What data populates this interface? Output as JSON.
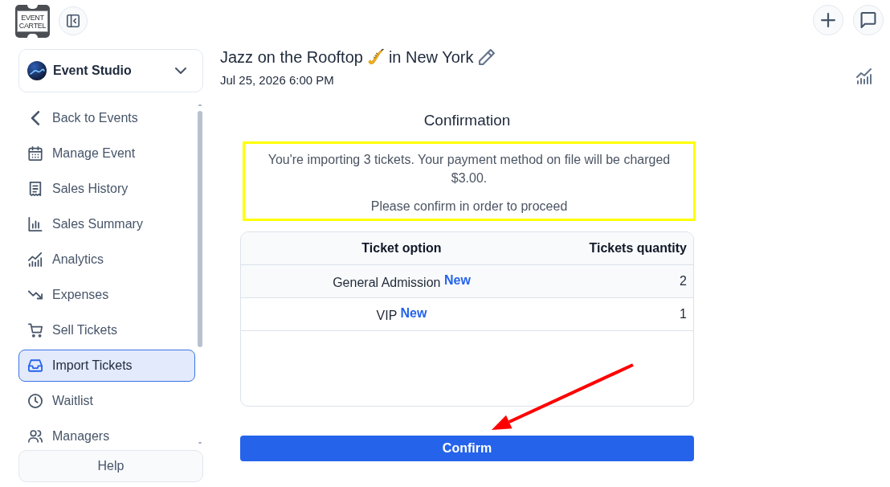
{
  "logo": {
    "lines": [
      "EVENT",
      "CARTEL"
    ]
  },
  "organization": {
    "name": "Event Studio"
  },
  "sidebar": {
    "items": [
      {
        "label": "Back to Events",
        "selected": false
      },
      {
        "label": "Manage Event",
        "selected": false
      },
      {
        "label": "Sales History",
        "selected": false
      },
      {
        "label": "Sales Summary",
        "selected": false
      },
      {
        "label": "Analytics",
        "selected": false
      },
      {
        "label": "Expenses",
        "selected": false
      },
      {
        "label": "Sell Tickets",
        "selected": false
      },
      {
        "label": "Import Tickets",
        "selected": true
      },
      {
        "label": "Waitlist",
        "selected": false
      },
      {
        "label": "Managers",
        "selected": false
      }
    ],
    "help_button": "Help"
  },
  "event": {
    "title_parts": [
      "Jazz on the Rooftop",
      "in New York"
    ],
    "date": "Jul 25, 2026 6:00 PM"
  },
  "confirmation": {
    "heading": "Confirmation",
    "message": "You're importing 3 tickets. Your payment method on file will be charged $3.00.",
    "prompt": "Please confirm in order to proceed",
    "table": {
      "columns": [
        "Ticket option",
        "Tickets quantity"
      ],
      "rows": [
        {
          "ticket_option": "General Admission",
          "badge": "New",
          "quantity": "2"
        },
        {
          "ticket_option": "VIP",
          "badge": "New",
          "quantity": "1"
        }
      ]
    },
    "confirm_button": "Confirm"
  }
}
